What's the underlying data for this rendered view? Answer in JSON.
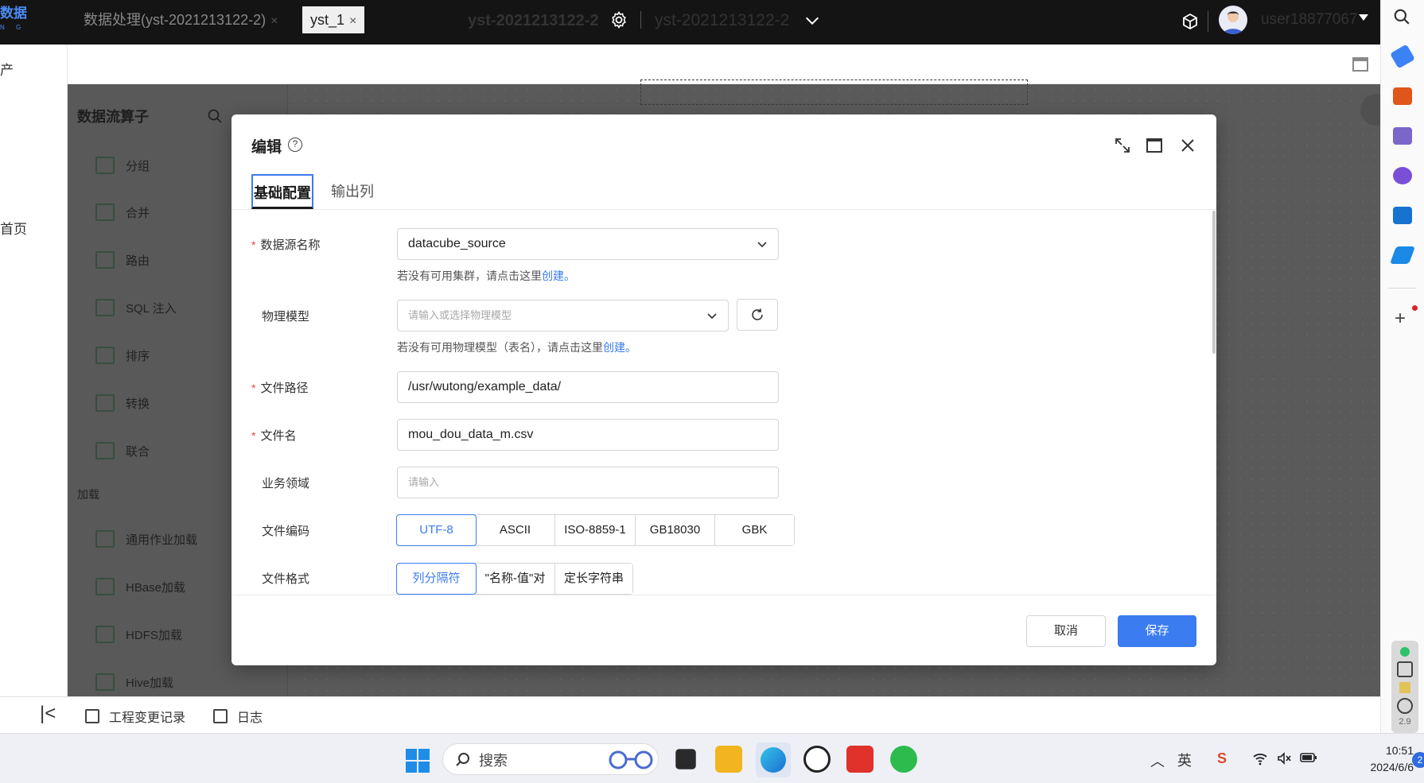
{
  "topbar": {
    "brand": "数据",
    "brand_sub": "N G",
    "workspace": "yst-2021213122-2",
    "project": "yst-2021213122-2",
    "username": "user18877067"
  },
  "leftnav": {
    "item_a": "产",
    "home": "首页"
  },
  "tabs": [
    {
      "label": "数据处理(yst-2021213122-2)",
      "close": "×"
    },
    {
      "label": "yst_1",
      "close": "×"
    }
  ],
  "sidebar": {
    "title": "数据流算子",
    "items": [
      "分组",
      "合并",
      "路由",
      "SQL 注入",
      "排序",
      "转换",
      "联合"
    ],
    "section": "加载",
    "load_items": [
      "通用作业加载",
      "HBase加载",
      "HDFS加载",
      "Hive加载"
    ]
  },
  "bottombar": {
    "change_log": "工程变更记录",
    "log": "日志"
  },
  "modal": {
    "title": "编辑",
    "help": "?",
    "tabs": [
      "基础配置",
      "输出列"
    ],
    "fields": {
      "datasource": {
        "label": "数据源名称",
        "value": "datacube_source"
      },
      "datasource_hint": {
        "text": "若没有可用集群，请点击这里",
        "link": "创建。"
      },
      "model": {
        "label": "物理模型",
        "placeholder": "请输入或选择物理模型"
      },
      "model_hint": {
        "text": "若没有可用物理模型（表名），请点击这里",
        "link": "创建。"
      },
      "path": {
        "label": "文件路径",
        "value": "/usr/wutong/example_data/"
      },
      "filename": {
        "label": "文件名",
        "value": "mou_dou_data_m.csv"
      },
      "domain": {
        "label": "业务领域",
        "placeholder": "请输入"
      },
      "encoding": {
        "label": "文件编码",
        "options": [
          "UTF-8",
          "ASCII",
          "ISO-8859-1",
          "GB18030",
          "GBK"
        ],
        "selected": "UTF-8"
      },
      "format": {
        "label": "文件格式",
        "options": [
          "列分隔符",
          "\"名称-值\"对",
          "定长字符串"
        ],
        "selected": "列分隔符"
      }
    },
    "cancel": "取消",
    "save": "保存"
  },
  "taskbar": {
    "search": "搜索",
    "time": "10:51",
    "date": "2024/6/6",
    "notifications": "2",
    "ime": "英"
  },
  "rightbar": {
    "badge": "2.9"
  },
  "colors": {
    "accent": "#3b7cf0",
    "topbar": "#141414",
    "overlay": "#5a5a5a"
  }
}
